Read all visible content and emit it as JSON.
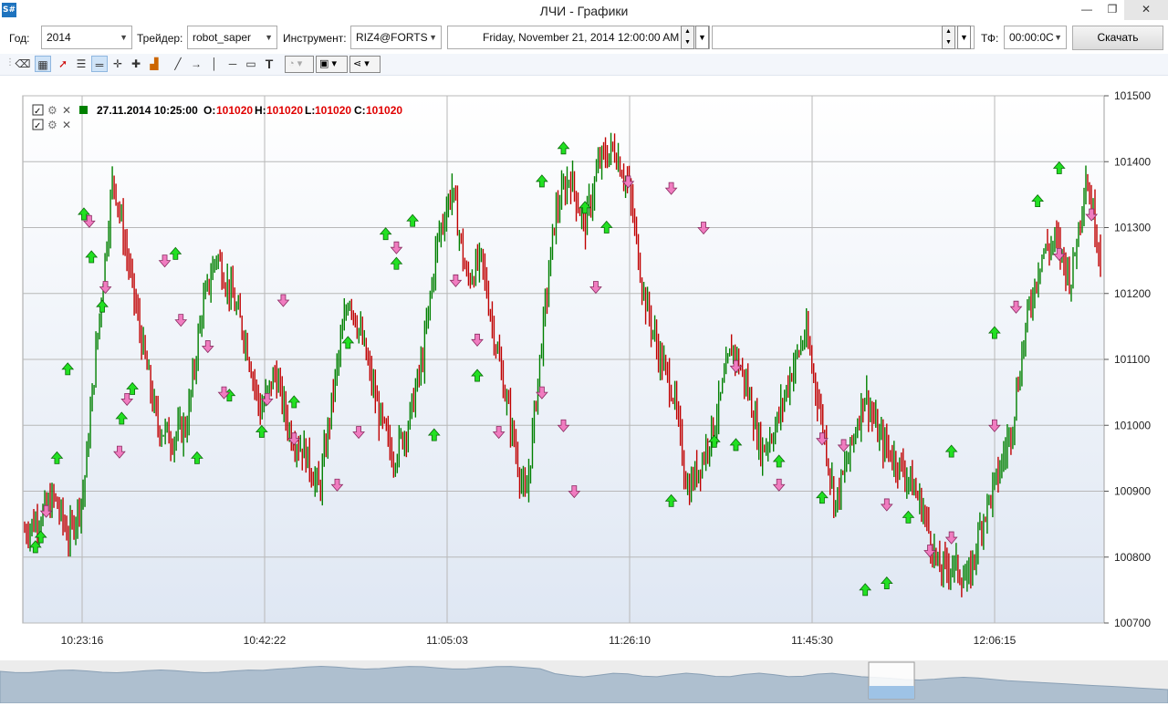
{
  "window": {
    "title": "ЛЧИ - Графики",
    "icon": "S#",
    "min": "—",
    "max": "❐",
    "close": "✕"
  },
  "toolbar": {
    "year_label": "Год:",
    "year_value": "2014",
    "trader_label": "Трейдер:",
    "trader_value": "robot_saper",
    "instrument_label": "Инструмент:",
    "instrument_value": "RIZ4@FORTS",
    "date_value": "Friday, November 21, 2014 12:00:00 AM",
    "tf_label": "ТФ:",
    "tf_value": "00:00:0C",
    "download_label": "Скачать"
  },
  "toolbar2_icons": [
    "eraser-icon",
    "chart-area-icon",
    "cursor-icon",
    "legend-icon",
    "line-width-icon",
    "crosshair-icon",
    "crosshair-plus-icon",
    "volume-icon",
    "draw-line-icon",
    "draw-arrow-icon",
    "vertical-line-icon",
    "horizontal-line-icon",
    "rectangle-icon",
    "text-icon",
    "fill-icon",
    "save-icon",
    "share-icon"
  ],
  "colors": {
    "up": "#008000",
    "down": "#c00000",
    "grid": "#b8b8b8",
    "buy_arrow": "#22e022",
    "sell_arrow": "#f07cc0",
    "values": "#e00000"
  },
  "legend": {
    "date": "27.11.2014 10:25:00",
    "o_label": "O:",
    "o_value": "101020",
    "h_label": "H:",
    "h_value": "101020",
    "l_label": "L:",
    "l_value": "101020",
    "c_label": "C:",
    "c_value": "101020"
  },
  "chart_data": {
    "type": "candlestick",
    "x_ticks": [
      "10:23:16",
      "10:42:22",
      "11:05:03",
      "11:26:10",
      "11:45:30",
      "12:06:15"
    ],
    "y_ticks": [
      100700,
      100800,
      100900,
      101000,
      101100,
      101200,
      101300,
      101400,
      101500
    ],
    "ylim": [
      100700,
      101500
    ],
    "grid": true,
    "series_close_approx": [
      100840,
      100860,
      100890,
      100830,
      100900,
      101150,
      101380,
      101250,
      101120,
      101000,
      100980,
      101000,
      101170,
      101260,
      101200,
      101130,
      101020,
      101080,
      100990,
      100960,
      100900,
      101060,
      101200,
      101120,
      101020,
      100950,
      101000,
      101100,
      101280,
      101360,
      101220,
      101250,
      101120,
      101000,
      100880,
      101110,
      101320,
      101380,
      101300,
      101400,
      101420,
      101360,
      101200,
      101110,
      101050,
      100900,
      100950,
      101020,
      101120,
      101060,
      100960,
      101000,
      101080,
      101140,
      101020,
      100880,
      100960,
      101050,
      100980,
      100950,
      100920,
      100870,
      100780,
      100790,
      100760,
      100860,
      100920,
      101000,
      101160,
      101260,
      101280,
      101220,
      101380,
      101260
    ],
    "buy_signals": [
      [
        10,
        100815
      ],
      [
        15,
        100830
      ],
      [
        30,
        100950
      ],
      [
        40,
        101085
      ],
      [
        55,
        101320
      ],
      [
        62,
        101255
      ],
      [
        72,
        101180
      ],
      [
        90,
        101010
      ],
      [
        100,
        101055
      ],
      [
        140,
        101260
      ],
      [
        160,
        100950
      ],
      [
        190,
        101045
      ],
      [
        220,
        100990
      ],
      [
        250,
        101035
      ],
      [
        300,
        101125
      ],
      [
        335,
        101290
      ],
      [
        345,
        101245
      ],
      [
        360,
        101310
      ],
      [
        380,
        100985
      ],
      [
        420,
        101075
      ],
      [
        480,
        101370
      ],
      [
        500,
        101420
      ],
      [
        520,
        101330
      ],
      [
        540,
        101300
      ],
      [
        600,
        100885
      ],
      [
        640,
        100975
      ],
      [
        660,
        100970
      ],
      [
        700,
        100945
      ],
      [
        740,
        100890
      ],
      [
        780,
        100750
      ],
      [
        800,
        100760
      ],
      [
        820,
        100860
      ],
      [
        860,
        100960
      ],
      [
        900,
        101140
      ],
      [
        940,
        101340
      ],
      [
        960,
        101390
      ]
    ],
    "sell_signals": [
      [
        20,
        100870
      ],
      [
        60,
        101310
      ],
      [
        75,
        101210
      ],
      [
        88,
        100960
      ],
      [
        95,
        101040
      ],
      [
        130,
        101250
      ],
      [
        145,
        101160
      ],
      [
        170,
        101120
      ],
      [
        185,
        101050
      ],
      [
        225,
        101040
      ],
      [
        240,
        101190
      ],
      [
        250,
        100980
      ],
      [
        290,
        100910
      ],
      [
        310,
        100990
      ],
      [
        345,
        101270
      ],
      [
        400,
        101220
      ],
      [
        420,
        101130
      ],
      [
        440,
        100990
      ],
      [
        480,
        101050
      ],
      [
        500,
        101000
      ],
      [
        510,
        100900
      ],
      [
        530,
        101210
      ],
      [
        560,
        101370
      ],
      [
        600,
        101360
      ],
      [
        630,
        101300
      ],
      [
        660,
        101090
      ],
      [
        700,
        100910
      ],
      [
        740,
        100980
      ],
      [
        760,
        100970
      ],
      [
        800,
        100880
      ],
      [
        840,
        100810
      ],
      [
        860,
        100830
      ],
      [
        900,
        101000
      ],
      [
        920,
        101180
      ],
      [
        960,
        101260
      ],
      [
        990,
        101320
      ]
    ]
  }
}
